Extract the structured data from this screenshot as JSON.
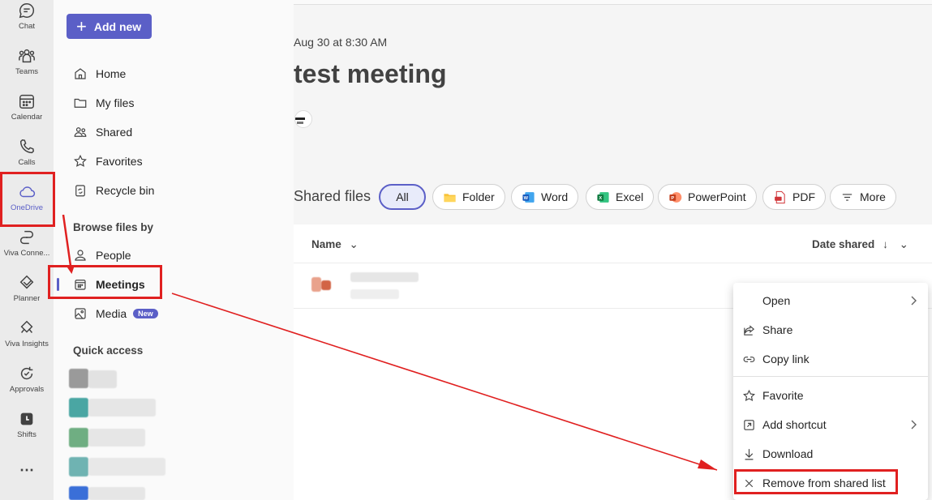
{
  "rail": [
    {
      "label": "Chat",
      "icon": "chat-icon"
    },
    {
      "label": "Teams",
      "icon": "teams-icon"
    },
    {
      "label": "Calendar",
      "icon": "calendar-icon"
    },
    {
      "label": "Calls",
      "icon": "phone-icon"
    },
    {
      "label": "OneDrive",
      "icon": "cloud-icon",
      "active": true
    },
    {
      "label": "Viva Conne...",
      "icon": "viva-connections-icon"
    },
    {
      "label": "Planner",
      "icon": "planner-icon"
    },
    {
      "label": "Viva Insights",
      "icon": "viva-insights-icon"
    },
    {
      "label": "Approvals",
      "icon": "approvals-icon"
    },
    {
      "label": "Shifts",
      "icon": "shifts-icon"
    }
  ],
  "pane": {
    "add_new": "Add new",
    "nav": [
      {
        "label": "Home",
        "icon": "home-icon"
      },
      {
        "label": "My files",
        "icon": "folder-icon"
      },
      {
        "label": "Shared",
        "icon": "people-icon"
      },
      {
        "label": "Favorites",
        "icon": "star-icon"
      },
      {
        "label": "Recycle bin",
        "icon": "recycle-bin-icon"
      }
    ],
    "browse_heading": "Browse files by",
    "browse": [
      {
        "label": "People",
        "icon": "person-icon"
      },
      {
        "label": "Meetings",
        "icon": "calendar-icon",
        "selected": true
      },
      {
        "label": "Media",
        "icon": "image-icon",
        "badge": "New"
      }
    ],
    "quick_access_heading": "Quick access"
  },
  "main": {
    "date": "Aug 30 at 8:30 AM",
    "title": "test meeting",
    "shared_files_heading": "Shared files",
    "filters": [
      {
        "label": "All",
        "active": true
      },
      {
        "label": "Folder",
        "icon": "folder-icon"
      },
      {
        "label": "Word",
        "icon": "word-icon"
      },
      {
        "label": "Excel",
        "icon": "excel-icon"
      },
      {
        "label": "PowerPoint",
        "icon": "powerpoint-icon"
      },
      {
        "label": "PDF",
        "icon": "pdf-icon"
      },
      {
        "label": "More",
        "icon": "filter-icon"
      }
    ],
    "columns": {
      "name": "Name",
      "date_shared": "Date shared"
    }
  },
  "context_menu": {
    "items": [
      {
        "label": "Open",
        "submenu": true
      },
      {
        "label": "Share",
        "icon": "share-icon"
      },
      {
        "label": "Copy link",
        "icon": "link-icon"
      },
      {
        "label": "Favorite",
        "icon": "star-icon"
      },
      {
        "label": "Add shortcut",
        "icon": "shortcut-icon",
        "submenu": true
      },
      {
        "label": "Download",
        "icon": "download-icon"
      },
      {
        "label": "Remove from shared list",
        "icon": "close-icon"
      }
    ]
  },
  "colors": {
    "accent": "#5b5fc7",
    "annotation": "#e02020"
  }
}
